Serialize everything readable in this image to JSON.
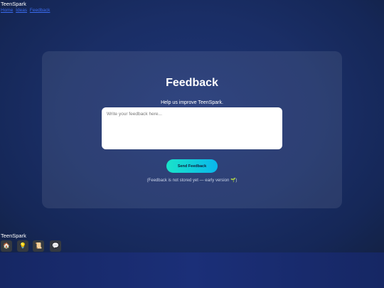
{
  "header": {
    "brand": "TeenSpark",
    "nav_links": [
      "Home",
      "Ideas",
      "Feedback"
    ]
  },
  "feedback_card": {
    "title": "Feedback",
    "subtitle": "Help us improve TeenSpark.",
    "textarea_placeholder": "Write your feedback here...",
    "submit_label": "Send Feedback",
    "note": "(Feedback is not stored yet — early version 🌱)"
  },
  "footer": {
    "brand": "TeenSpark",
    "icons": [
      {
        "name": "home-icon",
        "glyph": "🏠"
      },
      {
        "name": "lightbulb-icon",
        "glyph": "💡"
      },
      {
        "name": "scroll-icon",
        "glyph": "📜"
      },
      {
        "name": "speech-bubble-icon",
        "glyph": "💬"
      }
    ]
  },
  "colors": {
    "background": "#182a62",
    "card": "#2a3a72",
    "button_start": "#19e3c9",
    "button_end": "#0ab7ec",
    "link": "#3b6cf0",
    "icon_tile": "#353a41"
  }
}
